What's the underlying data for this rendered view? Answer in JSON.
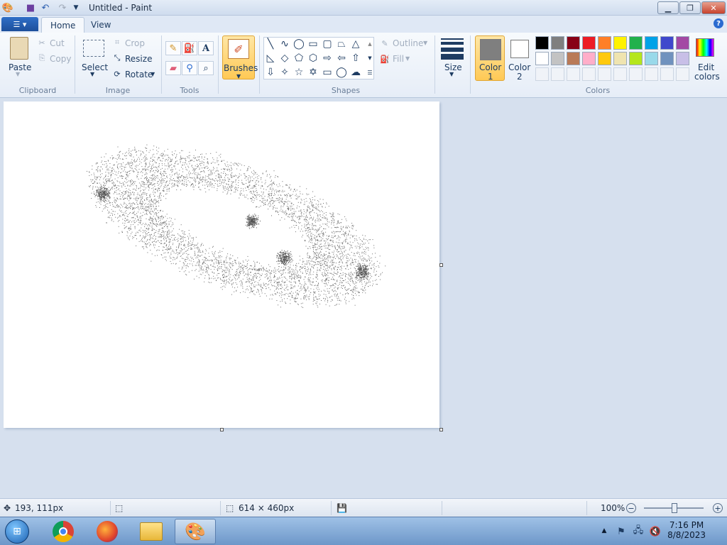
{
  "window": {
    "title": "Untitled - Paint"
  },
  "tabs": [
    {
      "label": "Home"
    },
    {
      "label": "View"
    }
  ],
  "clipboard": {
    "paste": "Paste",
    "cut": "Cut",
    "copy": "Copy",
    "group": "Clipboard"
  },
  "image": {
    "select": "Select",
    "crop": "Crop",
    "resize": "Resize",
    "rotate": "Rotate",
    "group": "Image"
  },
  "tools": {
    "group": "Tools"
  },
  "brushes": {
    "label": "Brushes"
  },
  "shapes": {
    "outline": "Outline",
    "fill": "Fill",
    "group": "Shapes"
  },
  "size": {
    "label": "Size"
  },
  "colors": {
    "color1_label": "Color",
    "color1_num": "1",
    "color2_label": "Color",
    "color2_num": "2",
    "edit_label": "Edit",
    "edit_label2": "colors",
    "group": "Colors",
    "color1_value": "#7f7f7f",
    "color2_value": "#ffffff",
    "palette_row1": [
      "#000000",
      "#7f7f7f",
      "#880015",
      "#ed1c24",
      "#ff7f27",
      "#fff200",
      "#22b14c",
      "#00a2e8",
      "#3f48cc",
      "#a349a4"
    ],
    "palette_row2": [
      "#ffffff",
      "#c3c3c3",
      "#b97a57",
      "#ffaec9",
      "#ffc90e",
      "#efe4b0",
      "#b5e61d",
      "#99d9ea",
      "#7092be",
      "#c8bfe7"
    ]
  },
  "status": {
    "cursor_pos": "193, 111px",
    "canvas_size": "614 × 460px",
    "zoom": "100%"
  },
  "taskbar": {
    "time": "7:16 PM",
    "date": "8/8/2023"
  }
}
